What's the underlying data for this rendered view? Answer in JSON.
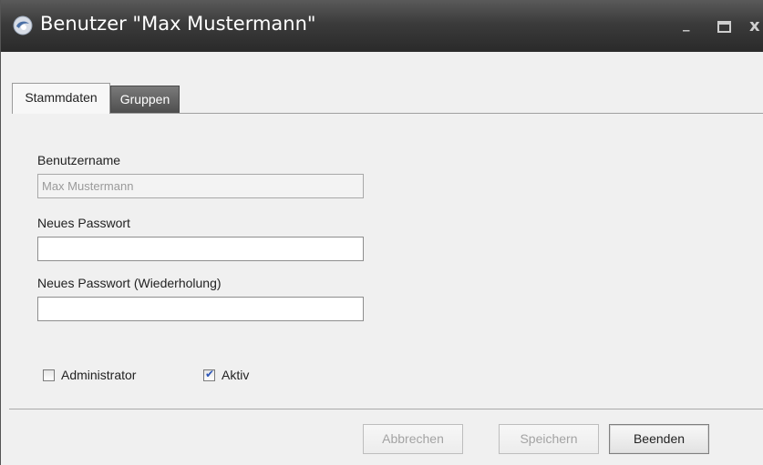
{
  "window": {
    "title": "Benutzer \"Max Mustermann\"",
    "controls": {
      "minimize": "_",
      "close": "x"
    }
  },
  "tabs": [
    {
      "label": "Stammdaten",
      "active": true
    },
    {
      "label": "Gruppen",
      "active": false
    }
  ],
  "form": {
    "username": {
      "label": "Benutzername",
      "value": "Max Mustermann",
      "disabled": true
    },
    "new_password": {
      "label": "Neues Passwort",
      "value": ""
    },
    "new_password_repeat": {
      "label": "Neues Passwort (Wiederholung)",
      "value": ""
    },
    "administrator": {
      "label": "Administrator",
      "checked": false
    },
    "active": {
      "label": "Aktiv",
      "checked": true
    }
  },
  "buttons": {
    "cancel": {
      "label": "Abbrechen",
      "disabled": true
    },
    "save": {
      "label": "Speichern",
      "disabled": true
    },
    "close": {
      "label": "Beenden",
      "disabled": false
    }
  },
  "icons": {
    "app": "app-logo-icon",
    "checkmark": "checkmark-icon"
  },
  "colors": {
    "titlebar": "#3b3b3b",
    "checkmark": "#2b55b8",
    "inactive_tab": "#5e5e5e"
  }
}
